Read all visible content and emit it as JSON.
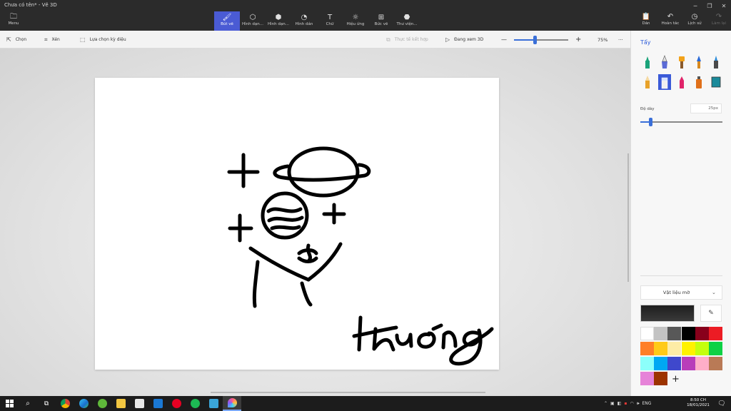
{
  "window": {
    "title": "Chưa có tên* - Vẽ 3D"
  },
  "ribbon": {
    "menu_label": "Menu",
    "tools": [
      {
        "label": "Bút vẽ",
        "icon": "brush-icon"
      },
      {
        "label": "Hình dạn...",
        "icon": "shapes-2d-icon"
      },
      {
        "label": "Hình dạn...",
        "icon": "shapes-3d-icon"
      },
      {
        "label": "Hình dán",
        "icon": "sticker-icon"
      },
      {
        "label": "Chữ",
        "icon": "text-icon"
      },
      {
        "label": "Hiệu ứng",
        "icon": "effects-icon"
      },
      {
        "label": "Bức vẽ",
        "icon": "canvas-icon"
      },
      {
        "label": "Thư viện...",
        "icon": "library-icon"
      }
    ],
    "active_tool": 0,
    "right": [
      {
        "label": "Dán",
        "icon": "paste-icon",
        "enabled": true
      },
      {
        "label": "Hoàn tác",
        "icon": "undo-icon",
        "enabled": true
      },
      {
        "label": "Lịch sử",
        "icon": "history-icon",
        "enabled": true
      },
      {
        "label": "Làm lại",
        "icon": "redo-icon",
        "enabled": false
      }
    ]
  },
  "subbar": {
    "select_label": "Chọn",
    "crop_label": "Xén",
    "magic_select_label": "Lựa chọn kỳ diệu",
    "mixed_reality_label": "Thực tế kết hợp",
    "view3d_label": "Đang xem 3D",
    "zoom_minus": "—",
    "zoom_plus": "+",
    "zoom_percent": "75%",
    "zoom_level": 0.38,
    "more": "···"
  },
  "panel": {
    "title": "Tẩy",
    "selected_brush": 6,
    "thickness_label": "Độ dày",
    "thickness_value": "25px",
    "thickness_level": 0.12,
    "material_label": "Vật liệu mờ",
    "current_color": "#1e1e1e",
    "add_color": "+",
    "palette": [
      "#ffffff",
      "#c3c3c3",
      "#585858",
      "#000000",
      "#88001b",
      "#ec1c24",
      "#ff7f27",
      "#ffca18",
      "#fdeca6",
      "#fff200",
      "#c4ff0e",
      "#0ed145",
      "#8cfffb",
      "#00a8f3",
      "#3f48cc",
      "#b83dba",
      "#ffaec8",
      "#b97a56",
      "#e683d8",
      "#9c3300"
    ]
  },
  "taskbar": {
    "language": "ENG",
    "time": "8:50 CH",
    "date": "18/01/2021"
  }
}
